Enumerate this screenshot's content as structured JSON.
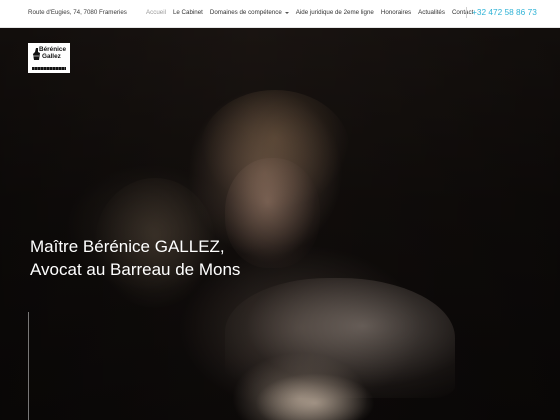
{
  "topbar": {
    "address": "Route d'Eugies, 74, 7080 Frameries",
    "nav": [
      {
        "label": "Accueil",
        "active": true,
        "dropdown": false
      },
      {
        "label": "Le Cabinet",
        "active": false,
        "dropdown": false
      },
      {
        "label": "Domaines de compétence",
        "active": false,
        "dropdown": true
      },
      {
        "label": "Aide juridique de 2eme ligne",
        "active": false,
        "dropdown": false
      },
      {
        "label": "Honoraires",
        "active": false,
        "dropdown": false
      },
      {
        "label": "Actualités",
        "active": false,
        "dropdown": false
      },
      {
        "label": "Contact",
        "active": false,
        "dropdown": false
      }
    ],
    "phone": "+32 472 58 86 73",
    "phone_color": "#2fb3d6"
  },
  "logo": {
    "line1": "Bérénice",
    "line2": "Gallez"
  },
  "hero": {
    "title_line1": "Maître Bérénice GALLEZ,",
    "title_line2": "Avocat au Barreau de Mons"
  }
}
